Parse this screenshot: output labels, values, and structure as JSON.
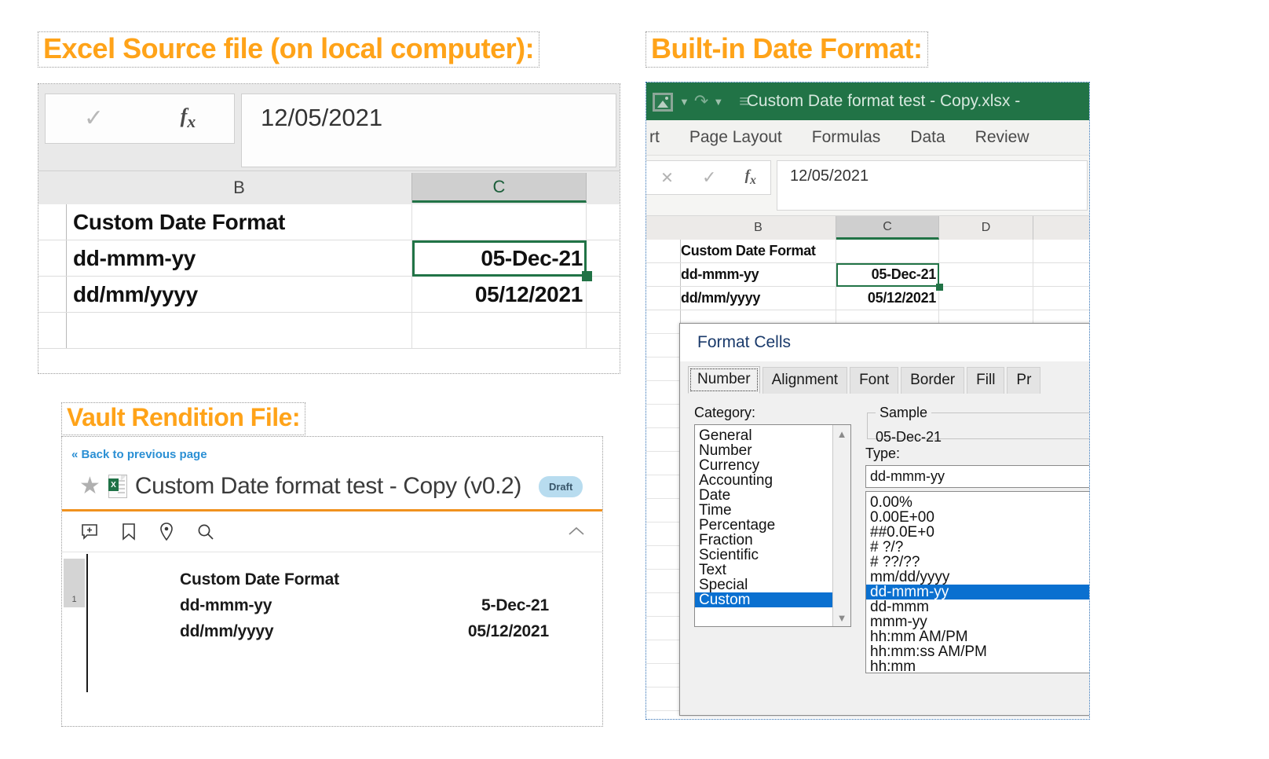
{
  "annotations": {
    "excel_source": "Excel Source file (on local computer):",
    "builtin_format": "Built-in Date Format:",
    "vault_rendition": "Vault Rendition File:"
  },
  "excel_source": {
    "formula_bar": {
      "value": "12/05/2021",
      "accept_icon": "checkmark-icon",
      "fx_icon": "fx-icon"
    },
    "columns": [
      "B",
      "C"
    ],
    "selected_column": "C",
    "rows": [
      {
        "b": "Custom Date Format",
        "c": ""
      },
      {
        "b": "dd-mmm-yy",
        "c": "05-Dec-21"
      },
      {
        "b": "dd/mm/yyyy",
        "c": "05/12/2021"
      },
      {
        "b": "",
        "c": ""
      }
    ],
    "selected_cell": "05-Dec-21",
    "selection_color": "#217346"
  },
  "vault": {
    "back_link": "« Back to previous page",
    "file_title": "Custom Date format test - Copy (v0.2)",
    "status_badge": "Draft",
    "star_icon": "star-icon",
    "file_icon": "excel-file-icon",
    "file_icon_letter": "X",
    "accent_rule_color": "#f0911e",
    "toolbar": [
      {
        "name": "add-comment-icon",
        "label": "Add comment"
      },
      {
        "name": "bookmark-icon",
        "label": "Bookmark"
      },
      {
        "name": "location-pin-icon",
        "label": "Place marker"
      },
      {
        "name": "search-icon",
        "label": "Search"
      }
    ],
    "collapse_icon": "chevron-up-icon",
    "page_number": "1",
    "document": {
      "heading": "Custom Date Format",
      "rows": [
        {
          "label": "dd-mmm-yy",
          "value": "5-Dec-21"
        },
        {
          "label": "dd/mm/yyyy",
          "value": "05/12/2021"
        }
      ]
    }
  },
  "builtin": {
    "titlebar": {
      "title": "Custom Date format test - Copy.xlsx  -",
      "undo_icon": "undo-icon",
      "redo_icon": "redo-icon",
      "customize_icon": "customize-quick-access-toolbar-icon",
      "bar_color": "#217346"
    },
    "ribbon_tabs": [
      "rt",
      "Page Layout",
      "Formulas",
      "Data",
      "Review"
    ],
    "formula_bar": {
      "value": "12/05/2021",
      "cancel_icon": "cancel-icon",
      "accept_icon": "checkmark-icon",
      "fx_icon": "fx-icon"
    },
    "columns": [
      "B",
      "C",
      "D"
    ],
    "selected_column": "C",
    "rows": [
      {
        "b": "Custom Date Format",
        "c": ""
      },
      {
        "b": "dd-mmm-yy",
        "c": "05-Dec-21"
      },
      {
        "b": "dd/mm/yyyy",
        "c": "05/12/2021"
      }
    ],
    "dialog": {
      "title": "Format Cells",
      "tabs": [
        "Number",
        "Alignment",
        "Font",
        "Border",
        "Fill",
        "Pr"
      ],
      "active_tab": "Number",
      "category_label": "Category:",
      "categories": [
        "General",
        "Number",
        "Currency",
        "Accounting",
        "Date",
        "Time",
        "Percentage",
        "Fraction",
        "Scientific",
        "Text",
        "Special",
        "Custom"
      ],
      "selected_category": "Custom",
      "sample_label": "Sample",
      "sample_value": "05-Dec-21",
      "type_label": "Type:",
      "type_value": "dd-mmm-yy",
      "type_list": [
        "0.00%",
        "0.00E+00",
        "##0.0E+0",
        "# ?/?",
        "# ??/??",
        "mm/dd/yyyy",
        "dd-mmm-yy",
        "dd-mmm",
        "mmm-yy",
        "hh:mm AM/PM",
        "hh:mm:ss AM/PM",
        "hh:mm"
      ],
      "selected_type": "dd-mmm-yy",
      "highlight_color": "#0a70d0"
    }
  }
}
